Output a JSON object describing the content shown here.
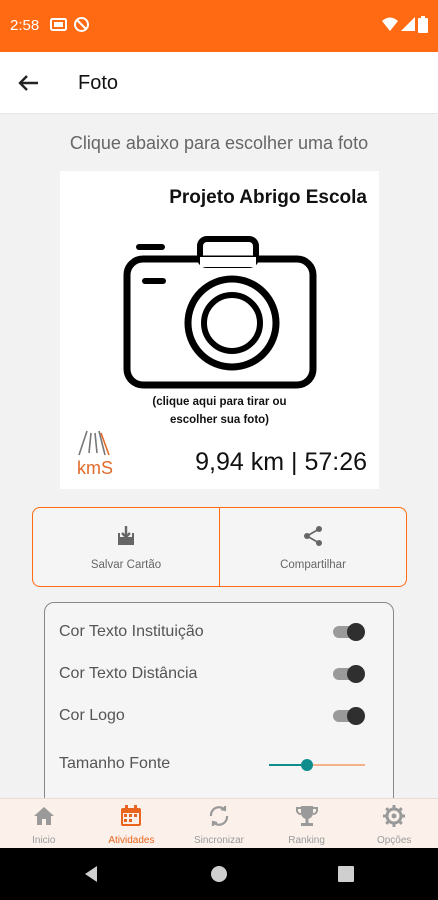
{
  "status_bar": {
    "time": "2:58",
    "background": "#ff6a13",
    "left_icons": [
      "gallery-icon",
      "blocked-icon"
    ],
    "right_icons": [
      "wifi-icon",
      "signal-icon",
      "battery-icon"
    ]
  },
  "app_bar": {
    "title": "Foto",
    "back_icon": "arrow-left-icon"
  },
  "instruction": "Clique abaixo para escolher uma foto",
  "card": {
    "institution": "Projeto Abrigo Escola",
    "hint_line1": "(clique aqui para tirar ou",
    "hint_line2": "escolher sua foto)",
    "logo_text": "kmS",
    "stats": "9,94 km | 57:26"
  },
  "actions": {
    "save_label": "Salvar Cartão",
    "share_label": "Compartilhar"
  },
  "settings": {
    "text_institution_label": "Cor Texto Instituição",
    "text_distance_label": "Cor Texto Distância",
    "logo_label": "Cor Logo",
    "font_size_label": "Tamanho Fonte",
    "toggle_institution_on": true,
    "toggle_distance_on": true,
    "toggle_logo_on": true,
    "font_size_fraction": 0.4
  },
  "bottom_nav": {
    "items": [
      {
        "label": "Inicio",
        "icon": "home-icon",
        "active": false
      },
      {
        "label": "Atividades",
        "icon": "calendar-icon",
        "active": true
      },
      {
        "label": "Sincronizar",
        "icon": "sync-icon",
        "active": false
      },
      {
        "label": "Ranking",
        "icon": "trophy-icon",
        "active": false
      },
      {
        "label": "Opções",
        "icon": "gear-icon",
        "active": false
      }
    ]
  },
  "colors": {
    "accent": "#ff6a13",
    "active_nav": "#e8641f",
    "slider": "#0f8d8d"
  }
}
